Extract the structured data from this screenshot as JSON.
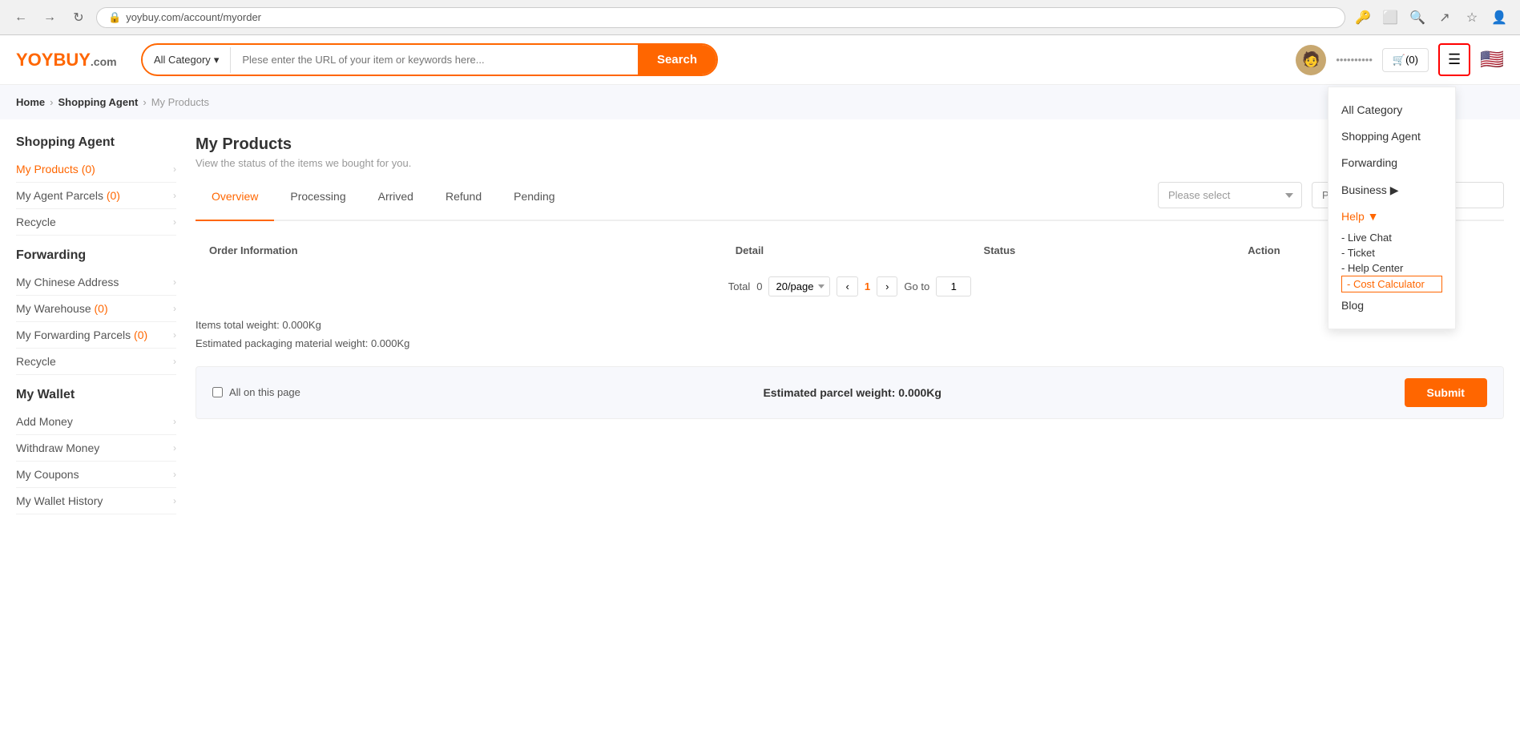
{
  "browser": {
    "url": "yoybuy.com/account/myorder",
    "back_label": "←",
    "forward_label": "→",
    "refresh_label": "↻"
  },
  "header": {
    "logo": {
      "yoy": "YOY",
      "buy": "BUY",
      "com": ".com"
    },
    "search": {
      "category": "All Category",
      "placeholder": "Plese enter the URL of your item or keywords here...",
      "button": "Search"
    },
    "user": {
      "avatar_char": "👤",
      "name": "••••••••••"
    },
    "cart": {
      "label": "🛒(0)"
    },
    "menu_icon": "☰",
    "flag": "🇺🇸"
  },
  "dropdown": {
    "items": [
      {
        "label": "All Category",
        "type": "normal"
      },
      {
        "label": "Shopping Agent",
        "type": "normal"
      },
      {
        "label": "Forwarding",
        "type": "normal"
      },
      {
        "label": "Business ▶",
        "type": "normal"
      },
      {
        "label": "Help ▼",
        "type": "orange"
      },
      {
        "label": "- Live Chat",
        "type": "sub"
      },
      {
        "label": "- Ticket",
        "type": "sub"
      },
      {
        "label": "- Help Center",
        "type": "sub"
      },
      {
        "label": "- Cost Calculator",
        "type": "highlight"
      },
      {
        "label": "Blog",
        "type": "normal"
      }
    ]
  },
  "breadcrumb": {
    "items": [
      "Home",
      "Shopping Agent",
      "My Products"
    ]
  },
  "sidebar": {
    "sections": [
      {
        "title": "Shopping Agent",
        "items": [
          {
            "label": "My Products",
            "count": "(0)",
            "active": true
          },
          {
            "label": "My Agent Parcels",
            "count": "(0)",
            "active": false
          },
          {
            "label": "Recycle",
            "count": "",
            "active": false
          }
        ]
      },
      {
        "title": "Forwarding",
        "items": [
          {
            "label": "My Chinese Address",
            "count": "",
            "active": false
          },
          {
            "label": "My Warehouse",
            "count": "(0)",
            "active": false
          },
          {
            "label": "My Forwarding Parcels",
            "count": "(0)",
            "active": false
          },
          {
            "label": "Recycle",
            "count": "",
            "active": false
          }
        ]
      },
      {
        "title": "My Wallet",
        "items": [
          {
            "label": "Add Money",
            "count": "",
            "active": false
          },
          {
            "label": "Withdraw Money",
            "count": "",
            "active": false
          },
          {
            "label": "My Coupons",
            "count": "",
            "active": false
          },
          {
            "label": "My Wallet History",
            "count": "",
            "active": false
          }
        ]
      }
    ]
  },
  "content": {
    "title": "My Products",
    "subtitle": "View the status of the items we bought for you.",
    "tabs": [
      {
        "label": "Overview",
        "active": true
      },
      {
        "label": "Processing",
        "active": false
      },
      {
        "label": "Arrived",
        "active": false
      },
      {
        "label": "Refund",
        "active": false
      },
      {
        "label": "Pending",
        "active": false
      }
    ],
    "filter": {
      "select_placeholder": "Please select",
      "input_placeholder": "Please enter the item..."
    },
    "table": {
      "columns": [
        "Order Information",
        "Detail",
        "Status",
        "Action"
      ]
    },
    "pagination": {
      "total_label": "Total",
      "total": "0",
      "per_page": "20/page",
      "prev": "‹",
      "next": "›",
      "current_page": "1",
      "goto_label": "Go to",
      "goto_value": "1"
    },
    "weight": {
      "total_label": "Items total weight: 0.000Kg",
      "packaging_label": "Estimated packaging material weight: 0.000Kg"
    },
    "bottom_bar": {
      "all_label": "All on this page",
      "parcel_weight": "Estimated parcel weight: 0.000Kg",
      "submit": "Submit"
    }
  }
}
